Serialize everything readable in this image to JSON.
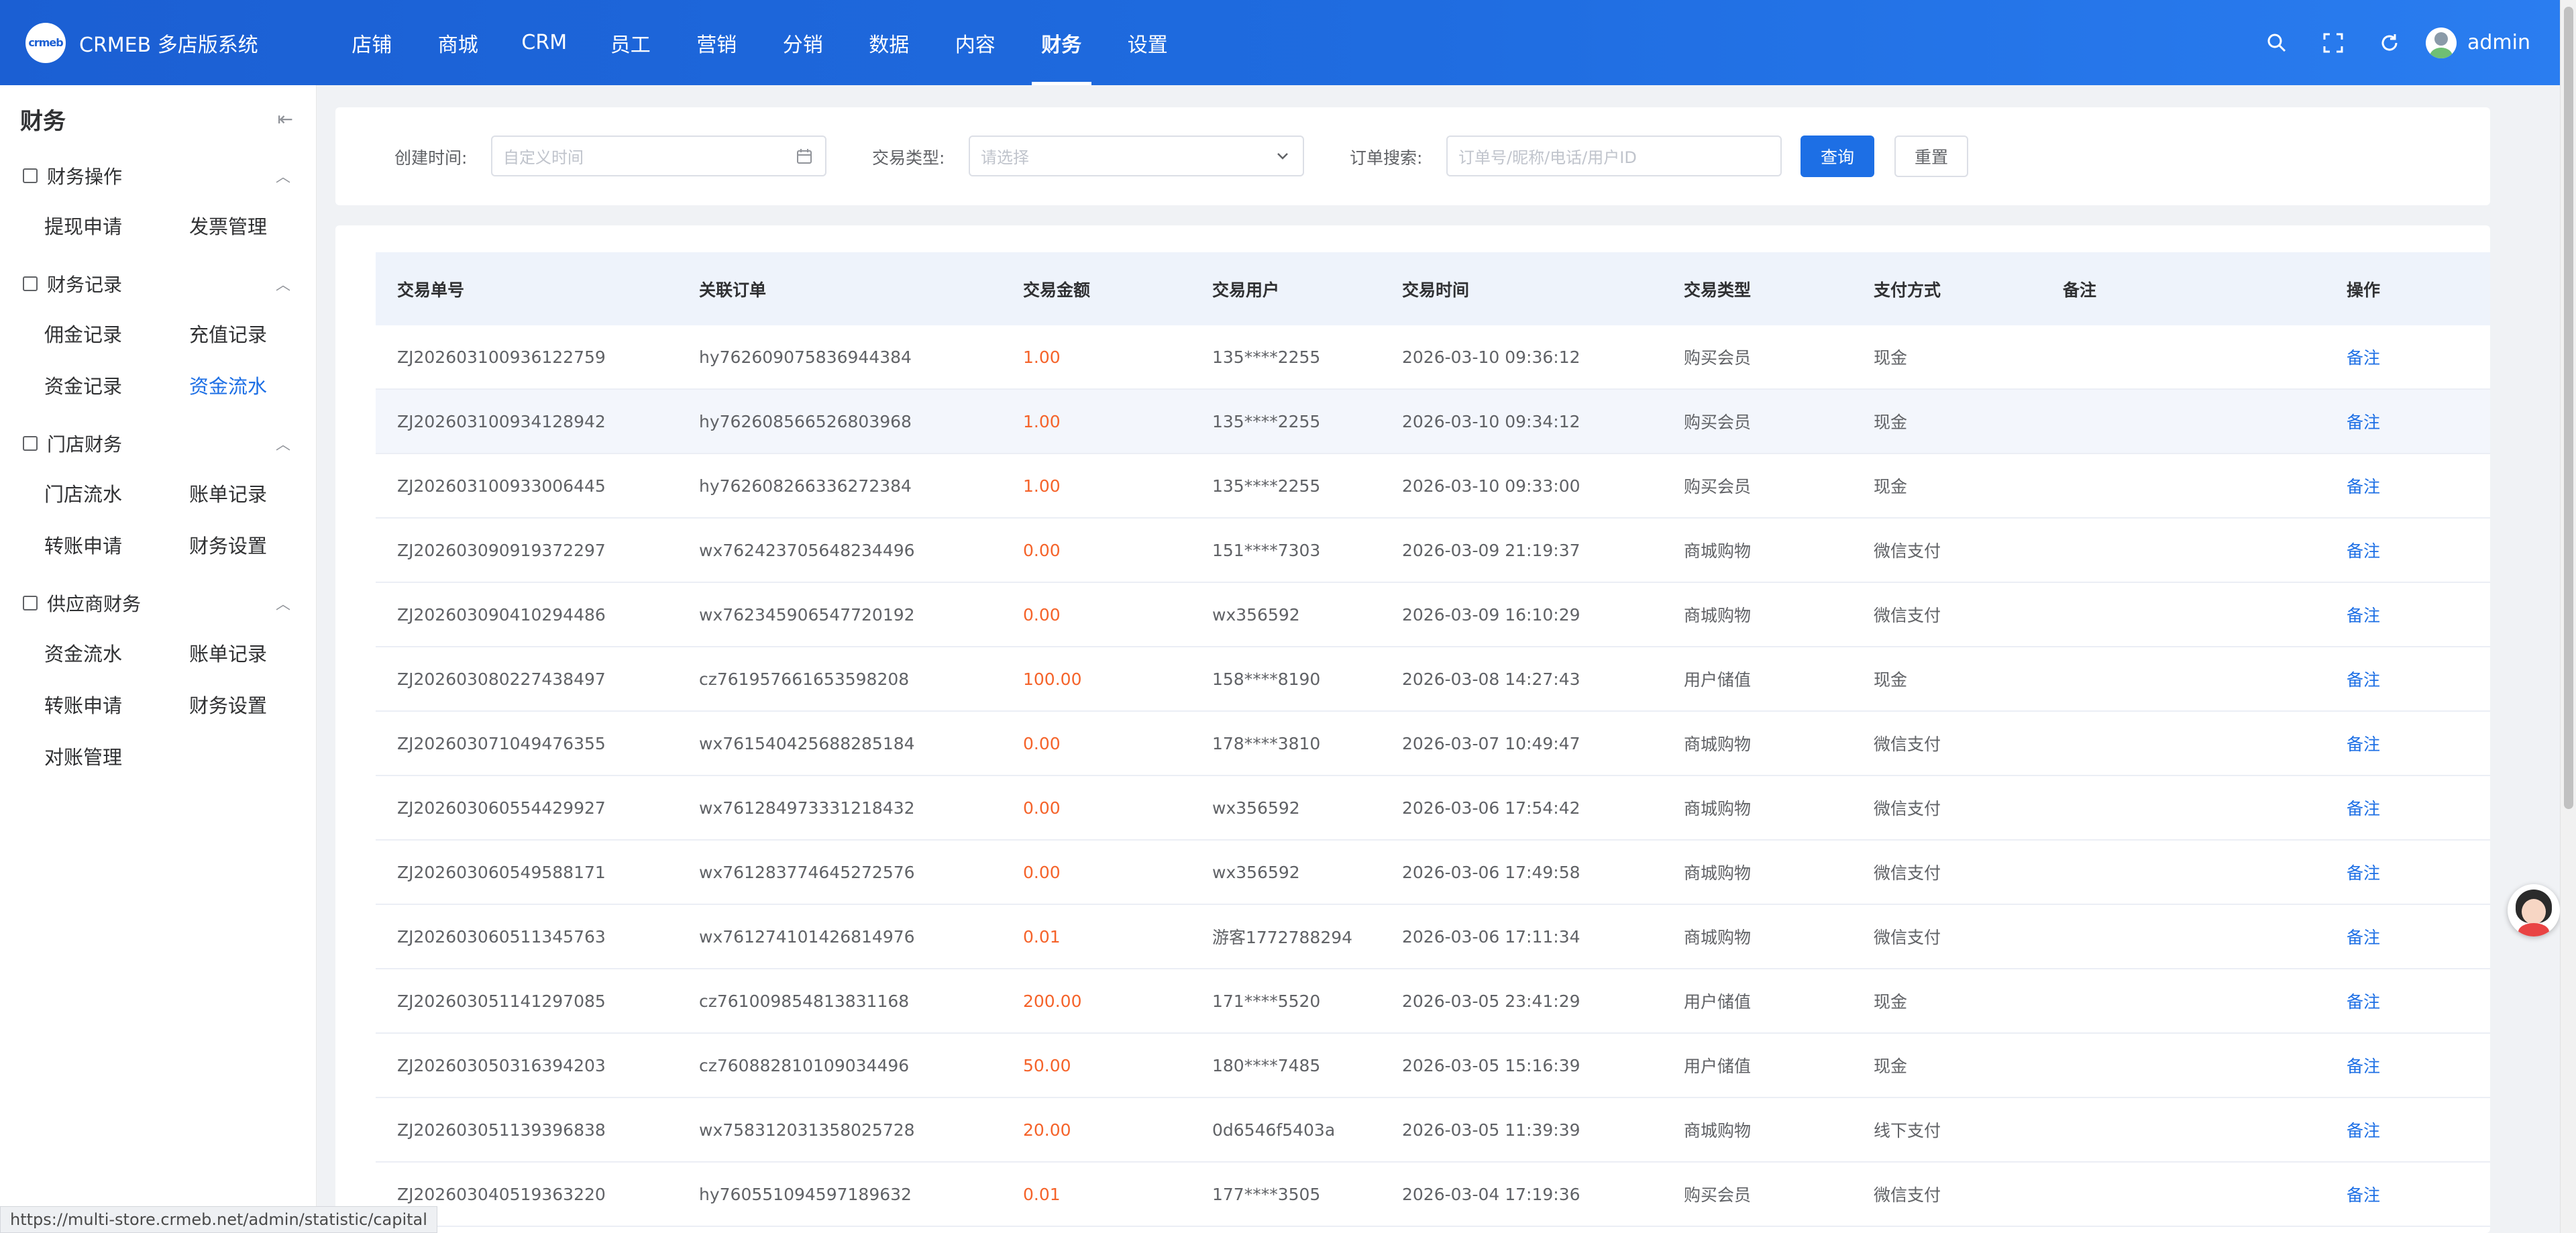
{
  "header": {
    "logo_mark": "crmeb",
    "app_name": "CRMEB 多店版系统",
    "nav": [
      "店铺",
      "商城",
      "CRM",
      "员工",
      "营销",
      "分销",
      "数据",
      "内容",
      "财务",
      "设置"
    ],
    "active_nav": "财务",
    "user_name": "admin",
    "icons": [
      "search-icon",
      "fullscreen-icon",
      "refresh-icon",
      "avatar"
    ]
  },
  "sidebar": {
    "title": "财务",
    "groups": [
      {
        "title": "财务操作",
        "icon": "clipboard-icon",
        "items": [
          "提现申请",
          "发票管理"
        ]
      },
      {
        "title": "财务记录",
        "icon": "list-icon",
        "items": [
          "佣金记录",
          "充值记录",
          "资金记录",
          "资金流水"
        ]
      },
      {
        "title": "门店财务",
        "icon": "wallet-icon",
        "items": [
          "门店流水",
          "账单记录",
          "转账申请",
          "财务设置"
        ]
      },
      {
        "title": "供应商财务",
        "icon": "card-icon",
        "items": [
          "资金流水",
          "账单记录",
          "转账申请",
          "财务设置",
          "对账管理"
        ]
      }
    ],
    "active_item": "资金流水"
  },
  "filters": {
    "created_label": "创建时间:",
    "created_placeholder": "自定义时间",
    "type_label": "交易类型:",
    "type_placeholder": "请选择",
    "search_label": "订单搜索:",
    "search_placeholder": "订单号/昵称/电话/用户ID",
    "query_button": "查询",
    "reset_button": "重置"
  },
  "table": {
    "columns": [
      "交易单号",
      "关联订单",
      "交易金额",
      "交易用户",
      "交易时间",
      "交易类型",
      "支付方式",
      "备注",
      "操作"
    ],
    "action_label": "备注",
    "rows": [
      [
        "ZJ202603100936122759",
        "hy762609075836944384",
        "1.00",
        "135****2255",
        "2026-03-10 09:36:12",
        "购买会员",
        "现金",
        ""
      ],
      [
        "ZJ202603100934128942",
        "hy762608566526803968",
        "1.00",
        "135****2255",
        "2026-03-10 09:34:12",
        "购买会员",
        "现金",
        ""
      ],
      [
        "ZJ202603100933006445",
        "hy762608266336272384",
        "1.00",
        "135****2255",
        "2026-03-10 09:33:00",
        "购买会员",
        "现金",
        ""
      ],
      [
        "ZJ202603090919372297",
        "wx762423705648234496",
        "0.00",
        "151****7303",
        "2026-03-09 21:19:37",
        "商城购物",
        "微信支付",
        ""
      ],
      [
        "ZJ202603090410294486",
        "wx762345906547720192",
        "0.00",
        "wx356592",
        "2026-03-09 16:10:29",
        "商城购物",
        "微信支付",
        ""
      ],
      [
        "ZJ202603080227438497",
        "cz761957661653598208",
        "100.00",
        "158****8190",
        "2026-03-08 14:27:43",
        "用户储值",
        "现金",
        ""
      ],
      [
        "ZJ202603071049476355",
        "wx761540425688285184",
        "0.00",
        "178****3810",
        "2026-03-07 10:49:47",
        "商城购物",
        "微信支付",
        ""
      ],
      [
        "ZJ202603060554429927",
        "wx761284973331218432",
        "0.00",
        "wx356592",
        "2026-03-06 17:54:42",
        "商城购物",
        "微信支付",
        ""
      ],
      [
        "ZJ202603060549588171",
        "wx761283774645272576",
        "0.00",
        "wx356592",
        "2026-03-06 17:49:58",
        "商城购物",
        "微信支付",
        ""
      ],
      [
        "ZJ202603060511345763",
        "wx761274101426814976",
        "0.01",
        "游客1772788294",
        "2026-03-06 17:11:34",
        "商城购物",
        "微信支付",
        ""
      ],
      [
        "ZJ202603051141297085",
        "cz761009854813831168",
        "200.00",
        "171****5520",
        "2026-03-05 23:41:29",
        "用户储值",
        "现金",
        ""
      ],
      [
        "ZJ202603050316394203",
        "cz760882810109034496",
        "50.00",
        "180****7485",
        "2026-03-05 15:16:39",
        "用户储值",
        "现金",
        ""
      ],
      [
        "ZJ202603051139396838",
        "wx758312031358025728",
        "20.00",
        "0d6546f5403a",
        "2026-03-05 11:39:39",
        "商城购物",
        "线下支付",
        ""
      ],
      [
        "ZJ202603040519363220",
        "hy760551094597189632",
        "0.01",
        "177****3505",
        "2026-03-04 17:19:36",
        "购买会员",
        "微信支付",
        ""
      ]
    ]
  },
  "status_url": "https://multi-store.crmeb.net/admin/statistic/capital",
  "colors": {
    "primary": "#1d6fe5",
    "amount": "#f5632a",
    "header_start": "#1b5fd3",
    "header_end": "#2a7df0"
  }
}
